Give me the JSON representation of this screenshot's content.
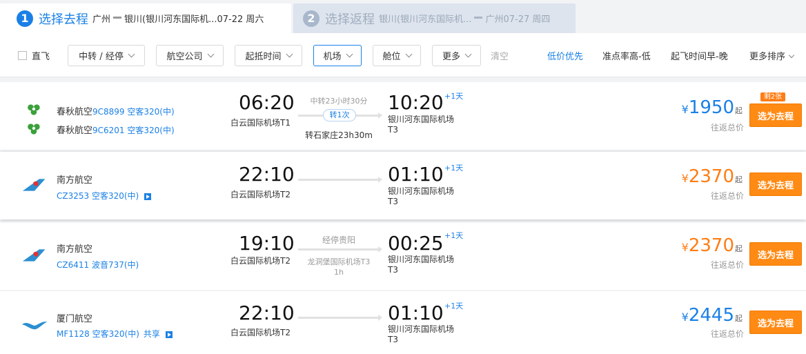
{
  "steps": [
    {
      "num": "1",
      "title": "选择去程",
      "route_from": "广州",
      "route_to": "银川(银川河东国际机...07-22 周六"
    },
    {
      "num": "2",
      "title": "选择返程",
      "route_from": "银川(银川河东国际机...",
      "route_to": "广州07-27 周四"
    }
  ],
  "filters": {
    "direct_label": "直飞",
    "dropdowns": [
      "中转 / 经停",
      "航空公司",
      "起抵时间",
      "机场",
      "舱位",
      "更多"
    ],
    "clear_label": "清空",
    "sorts": [
      "低价优先",
      "准点率高-低",
      "起飞时间早-晚",
      "更多排序"
    ]
  },
  "flights": [
    {
      "airlines": [
        {
          "name": "春秋航空",
          "code": "9C8899 空客320(中)"
        },
        {
          "name": "春秋航空",
          "code": "9C6201 空客320(中)"
        }
      ],
      "dep_time": "06:20",
      "dep_airport": "白云国际机场T1",
      "mid_top": "中转23小时30分",
      "transfer": "转1次",
      "mid_bottom": "转石家庄23h30m",
      "arr_time": "10:20",
      "arr_airport": "银川河东国际机场",
      "arr_terminal": "T3",
      "plus_day": "+1天",
      "badge": "剩2张",
      "currency": "¥",
      "price": "1950",
      "price_suffix": "起",
      "price_note": "往返总价",
      "button": "选为去程",
      "logo": "spring-airlines-logo"
    },
    {
      "airline_name": "南方航空",
      "flight_info": "CZ3253 空客320(中)",
      "dep_time": "22:10",
      "dep_airport": "白云国际机场T2",
      "arr_time": "01:10",
      "arr_airport": "银川河东国际机场",
      "arr_terminal": "T3",
      "plus_day": "+1天",
      "currency": "¥",
      "price": "2370",
      "price_suffix": "起",
      "price_note": "往返总价",
      "button": "选为去程",
      "logo": "china-southern-logo"
    },
    {
      "airline_name": "南方航空",
      "flight_info": "CZ6411 波音737(中)",
      "dep_time": "19:10",
      "dep_airport": "白云国际机场T2",
      "mid_top": "经停贵阳",
      "mid_bottom_1": "龙洞堡国际机场T3",
      "mid_bottom_2": "1h",
      "arr_time": "00:25",
      "arr_airport": "银川河东国际机场",
      "arr_terminal": "T3",
      "plus_day": "+1天",
      "currency": "¥",
      "price": "2370",
      "price_suffix": "起",
      "price_note": "往返总价",
      "button": "选为去程",
      "logo": "china-southern-logo"
    },
    {
      "airline_name": "厦门航空",
      "flight_info": "MF1128 空客320(中)",
      "share": "共享",
      "dep_time": "22:10",
      "dep_airport": "白云国际机场T2",
      "arr_time": "01:10",
      "arr_airport": "银川河东国际机场",
      "arr_terminal": "T3",
      "plus_day": "+1天",
      "currency": "¥",
      "price": "2445",
      "price_suffix": "起",
      "price_note": "往返总价",
      "button": "选为去程",
      "logo": "xiamen-airlines-logo"
    }
  ],
  "colors": {
    "accent": "#1a80e6",
    "orange": "#ff7d13",
    "button": "#ff8a14"
  }
}
